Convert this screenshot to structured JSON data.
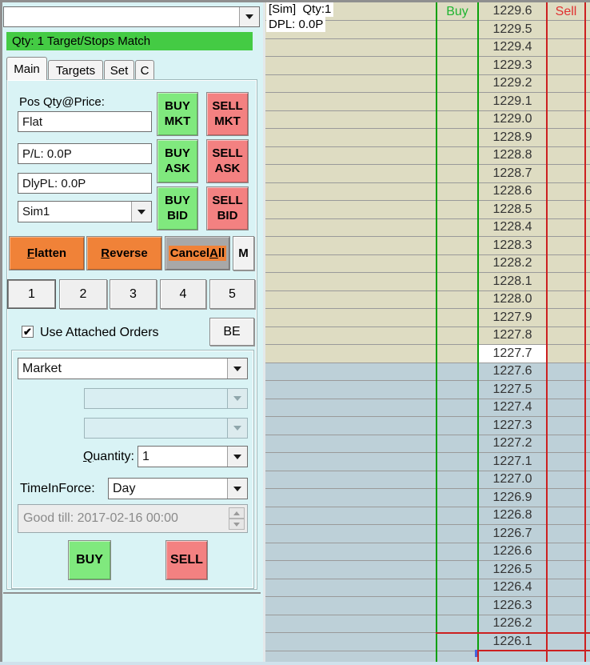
{
  "left_panel": {
    "symbol_combo": {
      "value": ""
    },
    "status_bar": {
      "text": "Qty: 1 Target/Stops Match",
      "bg": "#44cb44"
    },
    "tabs": [
      {
        "label": "Main",
        "active": true
      },
      {
        "label": "Targets",
        "active": false
      },
      {
        "label": "Set",
        "active": false
      },
      {
        "label": "C",
        "active": false
      }
    ],
    "position": {
      "label": "Pos Qty@Price:",
      "pos_value": "Flat",
      "pl_value": "P/L: 0.0P",
      "dlypl_value": "DlyPL: 0.0P",
      "account": "Sim1"
    },
    "trade_buttons": {
      "buy_mkt": {
        "line1": "BUY",
        "line2": "MKT"
      },
      "sell_mkt": {
        "line1": "SELL",
        "line2": "MKT"
      },
      "buy_ask": {
        "line1": "BUY",
        "line2": "ASK"
      },
      "sell_ask": {
        "line1": "SELL",
        "line2": "ASK"
      },
      "buy_bid": {
        "line1": "BUY",
        "line2": "BID"
      },
      "sell_bid": {
        "line1": "SELL",
        "line2": "BID"
      }
    },
    "actions": {
      "flatten": {
        "u": "F",
        "post": "latten"
      },
      "reverse": {
        "u": "R",
        "post": "everse"
      },
      "cancel_all": {
        "pre": "Cancel",
        "u": "A",
        "post": "ll"
      },
      "m": "M"
    },
    "qty_presets": {
      "labels": [
        "1",
        "2",
        "3",
        "4",
        "5"
      ],
      "selected": "1"
    },
    "attached_orders": {
      "label": "Use Attached Orders",
      "checked": true
    },
    "be_button": "BE",
    "order_entry": {
      "order_type": "Market",
      "attached_combo_1": "",
      "attached_combo_2": "",
      "quantity_label": {
        "u": "Q",
        "post": "uantity:"
      },
      "quantity": "1",
      "tif_label": "TimeInForce:",
      "tif": "Day",
      "good_till": "Good till: 2017-02-16 00:00",
      "buy": "BUY",
      "sell": "SELL"
    }
  },
  "ladder": {
    "overlay": {
      "line1": "[Sim]  Qty:1",
      "line2": "DPL: 0.0P"
    },
    "buy_header": "Buy",
    "sell_header": "Sell",
    "prices": [
      "1229.6",
      "1229.5",
      "1229.4",
      "1229.3",
      "1229.2",
      "1229.1",
      "1229.0",
      "1228.9",
      "1228.8",
      "1228.7",
      "1228.6",
      "1228.5",
      "1228.4",
      "1228.3",
      "1228.2",
      "1228.1",
      "1228.0",
      "1227.9",
      "1227.8",
      "1227.7",
      "1227.6",
      "1227.5",
      "1227.4",
      "1227.3",
      "1227.2",
      "1227.1",
      "1227.0",
      "1226.9",
      "1226.8",
      "1226.7",
      "1226.6",
      "1226.5",
      "1226.4",
      "1226.3",
      "1226.2",
      "1226.1"
    ],
    "last_price": "1227.7",
    "last_price_index": 19,
    "colors": {
      "ask_bg": "#dedcc2",
      "bid_bg": "#bdd0d8",
      "last_bg": "#ffffff",
      "grid": "#9a9a9a",
      "buy_line": "#0aa00a",
      "sell_line": "#cc2020",
      "buy_text": "#1fb431",
      "sell_text": "#e03030"
    }
  }
}
